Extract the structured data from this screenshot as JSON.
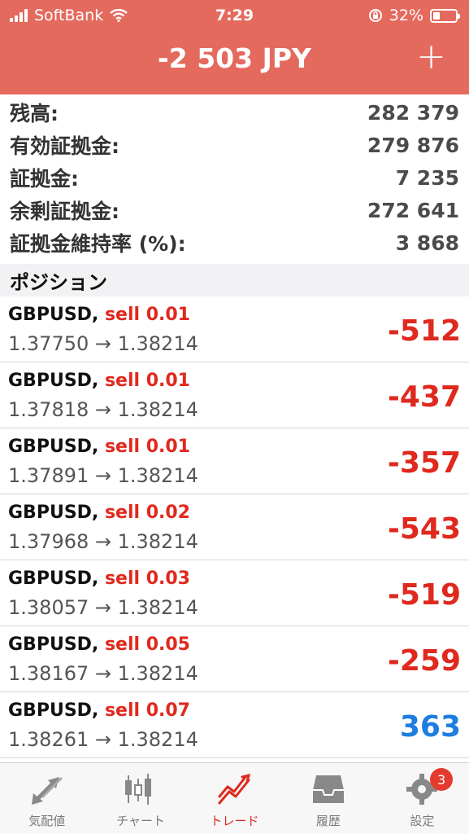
{
  "status_bar": {
    "carrier": "SoftBank",
    "time": "7:29",
    "battery": "32%"
  },
  "header": {
    "title": "-2 503 JPY",
    "add_label": "+"
  },
  "summary": [
    {
      "label": "残高:",
      "value": "282 379"
    },
    {
      "label": "有効証拠金:",
      "value": "279 876"
    },
    {
      "label": "証拠金:",
      "value": "7 235"
    },
    {
      "label": "余剰証拠金:",
      "value": "272 641"
    },
    {
      "label": "証拠金維持率 (%):",
      "value": "3 868"
    }
  ],
  "section": {
    "title": "ポジション"
  },
  "positions": [
    {
      "symbol": "GBPUSD,",
      "side": "sell 0.01",
      "prices": "1.37750 → 1.38214",
      "profit": "-512"
    },
    {
      "symbol": "GBPUSD,",
      "side": "sell 0.01",
      "prices": "1.37818 → 1.38214",
      "profit": "-437"
    },
    {
      "symbol": "GBPUSD,",
      "side": "sell 0.01",
      "prices": "1.37891 → 1.38214",
      "profit": "-357"
    },
    {
      "symbol": "GBPUSD,",
      "side": "sell 0.02",
      "prices": "1.37968 → 1.38214",
      "profit": "-543"
    },
    {
      "symbol": "GBPUSD,",
      "side": "sell 0.03",
      "prices": "1.38057 → 1.38214",
      "profit": "-519"
    },
    {
      "symbol": "GBPUSD,",
      "side": "sell 0.05",
      "prices": "1.38167 → 1.38214",
      "profit": "-259"
    },
    {
      "symbol": "GBPUSD,",
      "side": "sell 0.07",
      "prices": "1.38261 → 1.38214",
      "profit": "363"
    }
  ],
  "tabs": [
    {
      "label": "気配値",
      "icon": "quotes-arrows-icon"
    },
    {
      "label": "チャート",
      "icon": "candlestick-chart-icon"
    },
    {
      "label": "トレード",
      "icon": "trade-trend-icon",
      "active": true
    },
    {
      "label": "履歴",
      "icon": "history-inbox-icon"
    },
    {
      "label": "設定",
      "icon": "settings-gear-icon",
      "badge": "3"
    }
  ],
  "colors": {
    "header_bg": "#e46a5e",
    "loss": "#e0291e",
    "gain": "#1e7de0"
  }
}
